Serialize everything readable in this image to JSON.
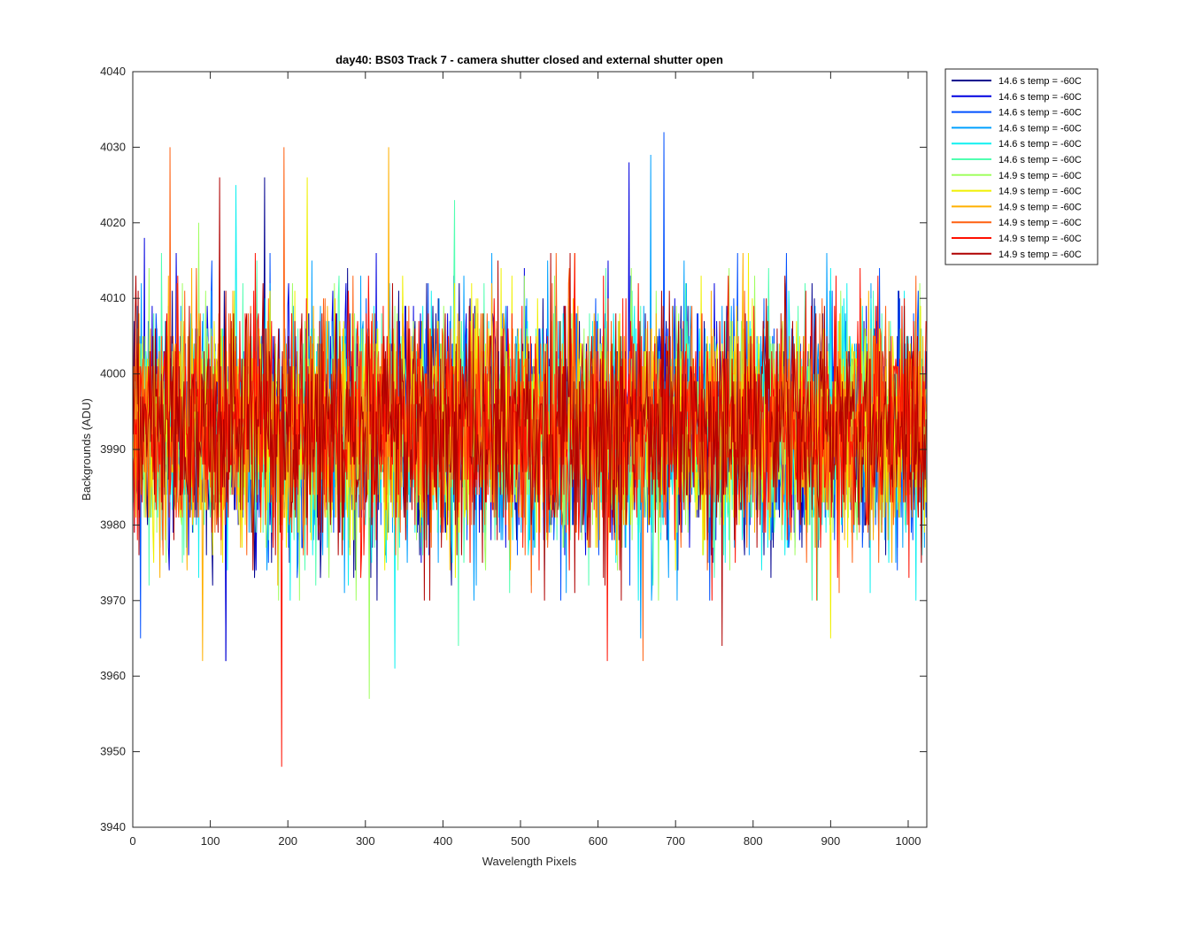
{
  "chart_data": {
    "type": "line",
    "title": "day40: BS03  Track 7 - camera shutter closed and external shutter open",
    "xlabel": "Wavelength Pixels",
    "ylabel": "Backgrounds (ADU)",
    "xlim": [
      0,
      1024
    ],
    "ylim": [
      3940,
      4040
    ],
    "xticks": [
      0,
      100,
      200,
      300,
      400,
      500,
      600,
      700,
      800,
      900,
      1000
    ],
    "yticks": [
      3940,
      3950,
      3960,
      3970,
      3980,
      3990,
      4000,
      4010,
      4020,
      4030,
      4040
    ],
    "grid": false,
    "legend_position": "outside-top-right",
    "n_points": 1024,
    "series": [
      {
        "name": "14.6 s temp = -60C",
        "color": "#00008f",
        "mean": 3993,
        "spread": 7.5,
        "peaks": [
          [
            170,
            4026
          ],
          [
            120,
            3962
          ]
        ]
      },
      {
        "name": "14.6 s temp = -60C",
        "color": "#0000e0",
        "mean": 3993,
        "spread": 7.5,
        "peaks": [
          [
            640,
            4028
          ],
          [
            15,
            4018
          ],
          [
            120,
            3962
          ]
        ]
      },
      {
        "name": "14.6 s temp = -60C",
        "color": "#0050ff",
        "mean": 3993,
        "spread": 7.5,
        "peaks": [
          [
            685,
            4032
          ],
          [
            10,
            3965
          ]
        ]
      },
      {
        "name": "14.6 s temp = -60C",
        "color": "#00a0ff",
        "mean": 3993,
        "spread": 7.5,
        "peaks": [
          [
            668,
            4029
          ],
          [
            655,
            3965
          ]
        ]
      },
      {
        "name": "14.6 s temp = -60C",
        "color": "#10f0f0",
        "mean": 3993,
        "spread": 7.5,
        "peaks": [
          [
            133,
            4025
          ],
          [
            338,
            3961
          ]
        ]
      },
      {
        "name": "14.6 s temp = -60C",
        "color": "#50ffb0",
        "mean": 3993,
        "spread": 7.5,
        "peaks": [
          [
            415,
            4023
          ],
          [
            420,
            3964
          ]
        ]
      },
      {
        "name": "14.9 s temp = -60C",
        "color": "#a0ff60",
        "mean": 3993,
        "spread": 7.5,
        "peaks": [
          [
            305,
            3957
          ],
          [
            85,
            4020
          ]
        ]
      },
      {
        "name": "14.9 s temp = -60C",
        "color": "#f0f000",
        "mean": 3993,
        "spread": 7.5,
        "peaks": [
          [
            225,
            4026
          ],
          [
            900,
            3965
          ]
        ]
      },
      {
        "name": "14.9 s temp = -60C",
        "color": "#ffb000",
        "mean": 3993,
        "spread": 7.5,
        "peaks": [
          [
            330,
            4030
          ],
          [
            90,
            3962
          ]
        ]
      },
      {
        "name": "14.9 s temp = -60C",
        "color": "#ff6010",
        "mean": 3993,
        "spread": 7.5,
        "peaks": [
          [
            48,
            4030
          ],
          [
            195,
            4030
          ],
          [
            658,
            3962
          ]
        ]
      },
      {
        "name": "14.9 s temp = -60C",
        "color": "#ff1000",
        "mean": 3993,
        "spread": 7.5,
        "peaks": [
          [
            192,
            3948
          ],
          [
            612,
            3962
          ]
        ]
      },
      {
        "name": "14.9 s temp = -60C",
        "color": "#b00000",
        "mean": 3993,
        "spread": 7.5,
        "peaks": [
          [
            112,
            4026
          ],
          [
            760,
            3964
          ]
        ]
      }
    ]
  }
}
